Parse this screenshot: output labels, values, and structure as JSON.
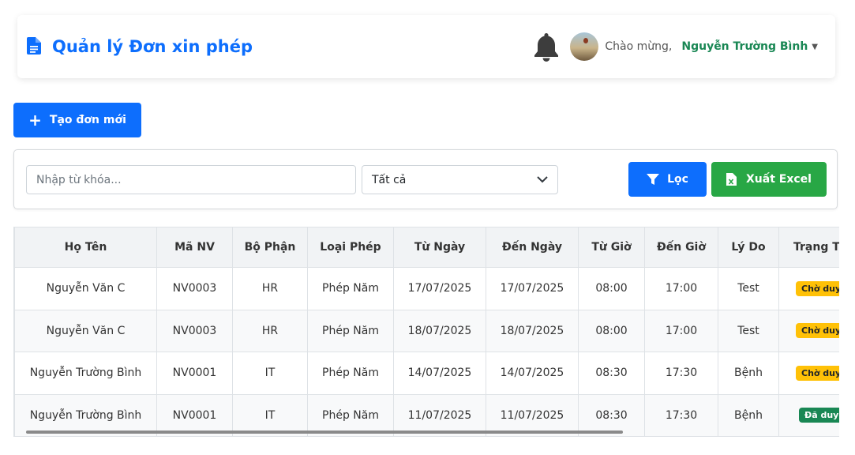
{
  "header": {
    "title": "Quản lý Đơn xin phép",
    "greeting": "Chào mừng,",
    "username": "Nguyễn Trường Bình"
  },
  "icons": {
    "brand": "document-icon",
    "notification": "bell-icon",
    "filter": "filter-icon",
    "excel": "excel-file-icon",
    "add": "plus-icon",
    "dropdown": "chevron-down-icon"
  },
  "actions": {
    "create_label": "Tạo đơn mới"
  },
  "filters": {
    "search_placeholder": "Nhập từ khóa...",
    "status_selected": "Tất cả",
    "filter_label": "Lọc",
    "export_label": "Xuất Excel"
  },
  "table": {
    "columns": [
      "Họ Tên",
      "Mã NV",
      "Bộ Phận",
      "Loại Phép",
      "Từ Ngày",
      "Đến Ngày",
      "Từ Giờ",
      "Đến Giờ",
      "Lý Do",
      "Trạng Thái"
    ],
    "rows": [
      {
        "name": "Nguyễn Văn C",
        "code": "NV0003",
        "dept": "HR",
        "type": "Phép Năm",
        "from_date": "17/07/2025",
        "to_date": "17/07/2025",
        "from_time": "08:00",
        "to_time": "17:00",
        "reason": "Test",
        "status": "Chờ duyệt"
      },
      {
        "name": "Nguyễn Văn C",
        "code": "NV0003",
        "dept": "HR",
        "type": "Phép Năm",
        "from_date": "18/07/2025",
        "to_date": "18/07/2025",
        "from_time": "08:00",
        "to_time": "17:00",
        "reason": "Test",
        "status": "Chờ duyệt"
      },
      {
        "name": "Nguyễn Trường Bình",
        "code": "NV0001",
        "dept": "IT",
        "type": "Phép Năm",
        "from_date": "14/07/2025",
        "to_date": "14/07/2025",
        "from_time": "08:30",
        "to_time": "17:30",
        "reason": "Bệnh",
        "status": "Chờ duyệt"
      },
      {
        "name": "Nguyễn Trường Bình",
        "code": "NV0001",
        "dept": "IT",
        "type": "Phép Năm",
        "from_date": "11/07/2025",
        "to_date": "11/07/2025",
        "from_time": "08:30",
        "to_time": "17:30",
        "reason": "Bệnh",
        "status": "Đã duyệt"
      }
    ]
  },
  "colors": {
    "primary": "#0d6efd",
    "success": "#28a745",
    "username": "#198754",
    "pending_badge": "#ffc107",
    "approved_badge": "#198754"
  }
}
